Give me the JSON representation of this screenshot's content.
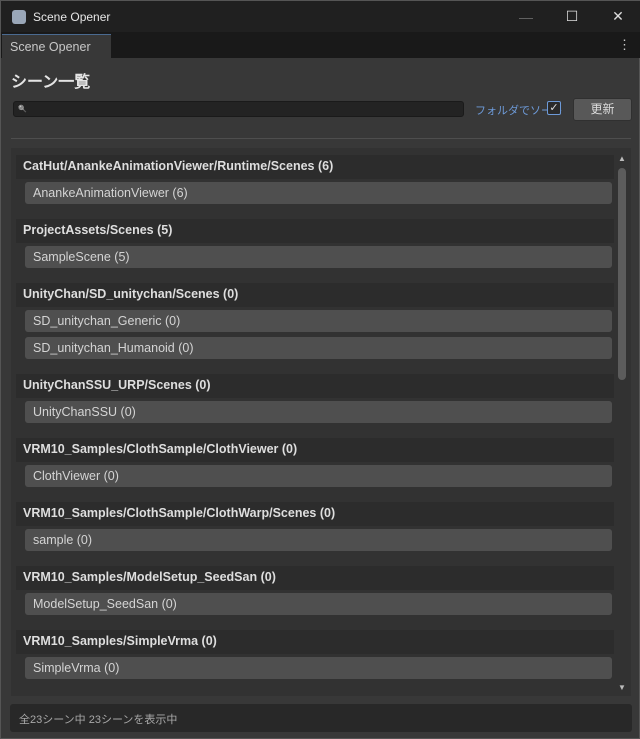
{
  "window": {
    "title": "Scene Opener",
    "minimize": "—",
    "maximize": "☐",
    "close": "✕"
  },
  "tab": {
    "label": "Scene Opener",
    "menu": "⋮"
  },
  "heading": "シーン一覧",
  "search": {
    "value": "",
    "icon": "🔍"
  },
  "sort": {
    "label": "フォルダでソート",
    "checked": true,
    "mark": "✓"
  },
  "refresh_label": "更新",
  "groups": [
    {
      "title": "CatHut/AnankeAnimationViewer/Runtime/Scenes   (6)",
      "items": [
        "AnankeAnimationViewer   (6)"
      ]
    },
    {
      "title": "ProjectAssets/Scenes   (5)",
      "items": [
        "SampleScene   (5)"
      ]
    },
    {
      "title": "UnityChan/SD_unitychan/Scenes   (0)",
      "items": [
        "SD_unitychan_Generic   (0)",
        "SD_unitychan_Humanoid   (0)"
      ]
    },
    {
      "title": "UnityChanSSU_URP/Scenes   (0)",
      "items": [
        "UnityChanSSU   (0)"
      ]
    },
    {
      "title": "VRM10_Samples/ClothSample/ClothViewer   (0)",
      "items": [
        "ClothViewer   (0)"
      ]
    },
    {
      "title": "VRM10_Samples/ClothSample/ClothWarp/Scenes   (0)",
      "items": [
        "sample   (0)"
      ]
    },
    {
      "title": "VRM10_Samples/ModelSetup_SeedSan   (0)",
      "items": [
        "ModelSetup_SeedSan   (0)"
      ]
    },
    {
      "title": "VRM10_Samples/SimpleVrma   (0)",
      "items": [
        "SimpleVrma   (0)"
      ]
    }
  ],
  "status": "全23シーン中 23シーンを表示中"
}
